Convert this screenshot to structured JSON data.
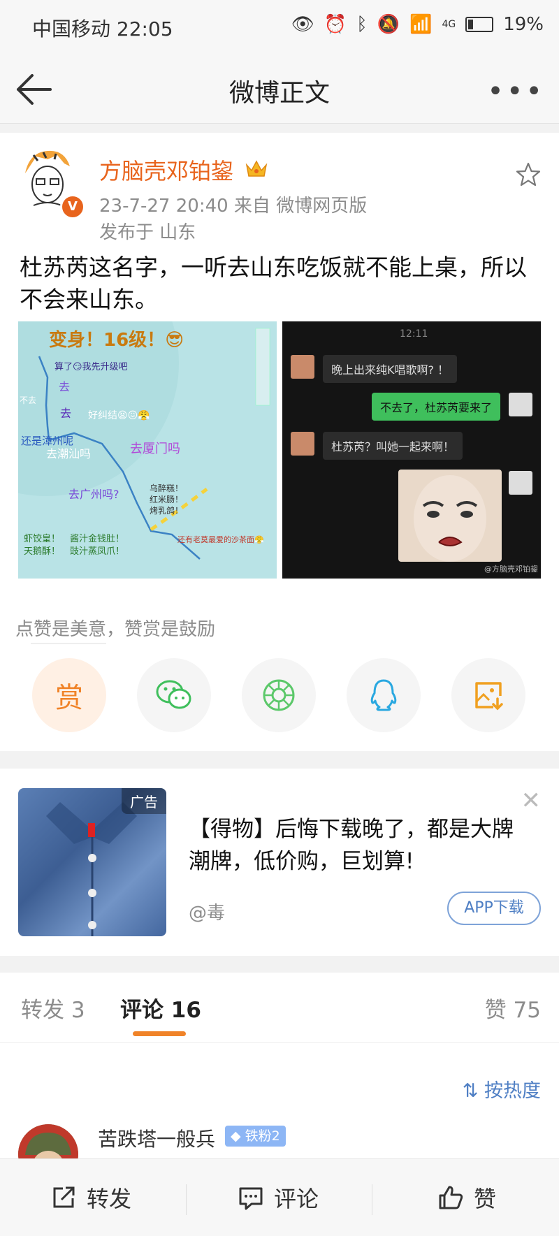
{
  "status_bar": {
    "carrier_time": "中国移动 22:05",
    "battery": "19%",
    "network": "4G"
  },
  "nav": {
    "title": "微博正文"
  },
  "post": {
    "author": "方脑壳邓铂鋆",
    "time_source": "23-7-27 20:40  来自 微博网页版",
    "location": "发布于 山东",
    "text": "杜苏芮这名字，一听去山东吃饭就不能上桌，所以不会来山东。",
    "image1": {
      "headline": "变身！16级！😎",
      "labels": [
        "算了😏我先升级吧",
        "去",
        "不去",
        "去",
        "好纠结😫😖😤",
        "还是漳州呢",
        "去潮汕吗",
        "去厦门吗",
        "去广州吗?",
        "乌醉糕！",
        "红米肠！",
        "烤乳鸽！",
        "虾饺皇！",
        "酱汁金钱肚！",
        "天鹅酥！",
        "豉汁蒸凤爪！",
        "还有老莫最爱的沙茶面😤"
      ]
    },
    "image2": {
      "time": "12:11",
      "msg1": "晚上出来纯K唱歌啊? ！",
      "msg2": "不去了，杜苏芮要来了",
      "msg3": "杜苏芮？叫她一起来啊！",
      "watermark": "@方脑壳邓铂鋆"
    },
    "tip": "点赞是美意，赞赏是鼓励",
    "reward_label": "赏"
  },
  "ad": {
    "tag": "广告",
    "text": "【得物】后悔下载晚了，都是大牌潮牌，低价购，巨划算!",
    "source": "@毒",
    "button": "APP下载"
  },
  "tabs": {
    "repost": "转发 3",
    "comments": "评论 16",
    "likes": "赞 75"
  },
  "comments": {
    "sort": "按热度",
    "first": {
      "name": "苦跌塔一般兵",
      "badge": "铁粉2"
    }
  },
  "bottom_bar": {
    "repost": "转发",
    "comment": "评论",
    "like": "赞"
  },
  "colors": {
    "accent": "#f08328",
    "username": "#e8641d",
    "link": "#4f7fc4"
  }
}
